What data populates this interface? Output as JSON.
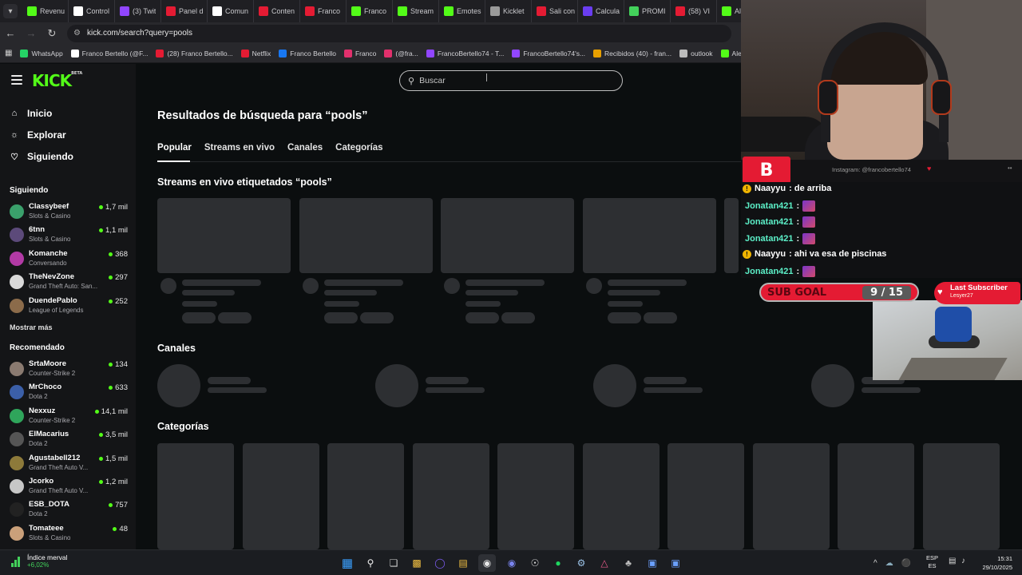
{
  "browser": {
    "tabs": [
      "Revenu",
      "Control",
      "(3) Twit",
      "Panel d",
      "Comun",
      "Conten",
      "Franco",
      "Franco",
      "Stream",
      "Emotes",
      "Kicklet",
      "Sali con",
      "Calcula",
      "PROMI",
      "(58) VI",
      "Aler"
    ],
    "tab_colors": [
      "#53fc18",
      "#ffffff",
      "#9146ff",
      "#e41b33",
      "#ffffff",
      "#e41b33",
      "#e41b33",
      "#53fc18",
      "#53fc18",
      "#53fc18",
      "#9a9a9a",
      "#e41b33",
      "#6a3df0",
      "#43d15b",
      "#e41b33",
      "#53fc18"
    ],
    "url": "kick.com/search?query=pools",
    "bookmarks": [
      "WhatsApp",
      "Franco Bertello (@F...",
      "(28) Franco Bertello...",
      "Netflix",
      "Franco Bertello",
      "Franco",
      "(@fra...",
      "FrancoBertello74 - T...",
      "FrancoBertello74's...",
      "Recibidos (40) - fran...",
      "outlook",
      "Aler"
    ],
    "bookmark_colors": [
      "#25d366",
      "#ffffff",
      "#e41b33",
      "#e41b33",
      "#1877f2",
      "#e1306c",
      "#e1306c",
      "#9146ff",
      "#9146ff",
      "#e8a000",
      "#bbbbbb",
      "#53fc18"
    ]
  },
  "kick": {
    "logo": "KICK",
    "logo_badge": "BETA",
    "search_placeholder": "Buscar",
    "nav": [
      {
        "label": "Inicio",
        "icon": "home-icon"
      },
      {
        "label": "Explorar",
        "icon": "compass-icon"
      },
      {
        "label": "Siguiendo",
        "icon": "heart-icon"
      }
    ],
    "following_header": "Siguiendo",
    "following": [
      {
        "name": "Classybeef",
        "game": "Slots & Casino",
        "viewers": "1,7 mil"
      },
      {
        "name": "6tnn",
        "game": "Slots & Casino",
        "viewers": "1,1 mil"
      },
      {
        "name": "Komanche",
        "game": "Conversando",
        "viewers": "368"
      },
      {
        "name": "TheNevZone",
        "game": "Grand Theft Auto: San...",
        "viewers": "297"
      },
      {
        "name": "DuendePablo",
        "game": "League of Legends",
        "viewers": "252"
      }
    ],
    "show_more": "Mostrar más",
    "recommended_header": "Recomendado",
    "recommended": [
      {
        "name": "SrtaMoore",
        "game": "Counter-Strike 2",
        "viewers": "134"
      },
      {
        "name": "MrChoco",
        "game": "Dota 2",
        "viewers": "633"
      },
      {
        "name": "Nexxuz",
        "game": "Counter-Strike 2",
        "viewers": "14,1 mil"
      },
      {
        "name": "ElMacarius",
        "game": "Dota 2",
        "viewers": "3,5 mil"
      },
      {
        "name": "Agustabell212",
        "game": "Grand Theft Auto V...",
        "viewers": "1,5 mil"
      },
      {
        "name": "Jcorko",
        "game": "Grand Theft Auto V...",
        "viewers": "1,2 mil"
      },
      {
        "name": "ESB_DOTA",
        "game": "Dota 2",
        "viewers": "757"
      },
      {
        "name": "Tomateee",
        "game": "Slots & Casino",
        "viewers": "48"
      }
    ],
    "avatar_colors": [
      "#3aa06b",
      "#5c4a7a",
      "#b23aa5",
      "#d9d9d9",
      "#8b6b4a",
      "#8a7a70",
      "#3b5fa8",
      "#2fa55b",
      "#555555",
      "#8d7a3a",
      "#c7c7c7",
      "#222222",
      "#caa07a"
    ],
    "results_title": "Resultados de búsqueda para “pools”",
    "tabs": [
      "Popular",
      "Streams en vivo",
      "Canales",
      "Categorías"
    ],
    "section_streams": "Streams en vivo etiquetados “pools”",
    "section_channels": "Canales",
    "section_categories": "Categorías"
  },
  "overlay": {
    "chat_logo": "B",
    "instagram": "Instagram: @francobertello74",
    "chat": [
      {
        "user": "Naayyu",
        "msg": ": de arriba",
        "badge": true
      },
      {
        "user": "Jonatan421",
        "msg": ":",
        "emote": true
      },
      {
        "user": "Jonatan421",
        "msg": ":",
        "emote": true
      },
      {
        "user": "Jonatan421",
        "msg": ":",
        "emote": true
      },
      {
        "user": "Naayyu",
        "msg": ": ahi va esa de piscinas",
        "badge": true
      },
      {
        "user": "Jonatan421",
        "msg": ":",
        "emote": true
      }
    ],
    "sub_goal_label": "SUB GOAL",
    "sub_goal_value": "9 / 15",
    "sub_goal_progress": 0.6,
    "last_sub_label": "Last Subscriber",
    "last_sub_name": "Lesyer27"
  },
  "taskbar": {
    "stock_name": "Índice merval",
    "stock_change": "+6,02%",
    "lang1": "ESP",
    "lang2": "ES",
    "time": "15:31",
    "date": "29/10/2025"
  }
}
